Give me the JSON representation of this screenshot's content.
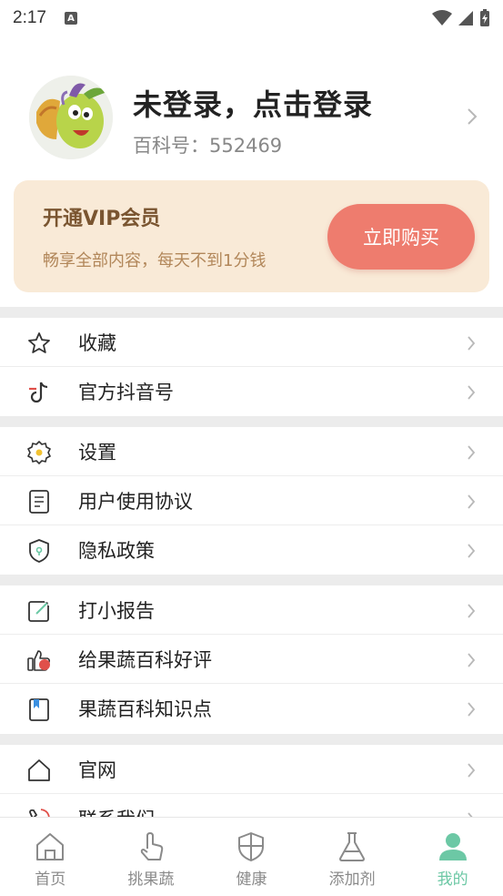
{
  "status_bar": {
    "time": "2:17",
    "notification_letter": "A"
  },
  "profile": {
    "name": "未登录，点击登录",
    "id_label": "百科号：",
    "id_value": "552469"
  },
  "vip": {
    "title": "开通VIP会员",
    "subtitle": "畅享全部内容，每天不到1分钱",
    "button": "立即购买"
  },
  "menu": {
    "group1": [
      {
        "label": "收藏",
        "icon": "star-icon"
      },
      {
        "label": "官方抖音号",
        "icon": "tiktok-icon"
      }
    ],
    "group2": [
      {
        "label": "设置",
        "icon": "gear-icon"
      },
      {
        "label": "用户使用协议",
        "icon": "document-icon"
      },
      {
        "label": "隐私政策",
        "icon": "shield-icon"
      }
    ],
    "group3": [
      {
        "label": "打小报告",
        "icon": "edit-icon"
      },
      {
        "label": "给果蔬百科好评",
        "icon": "thumbs-up-icon"
      },
      {
        "label": "果蔬百科知识点",
        "icon": "bookmark-icon"
      }
    ],
    "group4": [
      {
        "label": "官网",
        "icon": "home-icon"
      },
      {
        "label": "联系我们",
        "icon": "contact-icon"
      }
    ]
  },
  "tabs": [
    {
      "label": "首页",
      "icon": "home-icon"
    },
    {
      "label": "挑果蔬",
      "icon": "hand-icon"
    },
    {
      "label": "健康",
      "icon": "shield-icon"
    },
    {
      "label": "添加剂",
      "icon": "flask-icon"
    },
    {
      "label": "我的",
      "icon": "user-icon",
      "active": true
    }
  ],
  "colors": {
    "accent": "#6cc8a5",
    "vip_bg": "#f9ead7",
    "vip_button": "#ee7c6e",
    "vip_title": "#7a5530"
  }
}
